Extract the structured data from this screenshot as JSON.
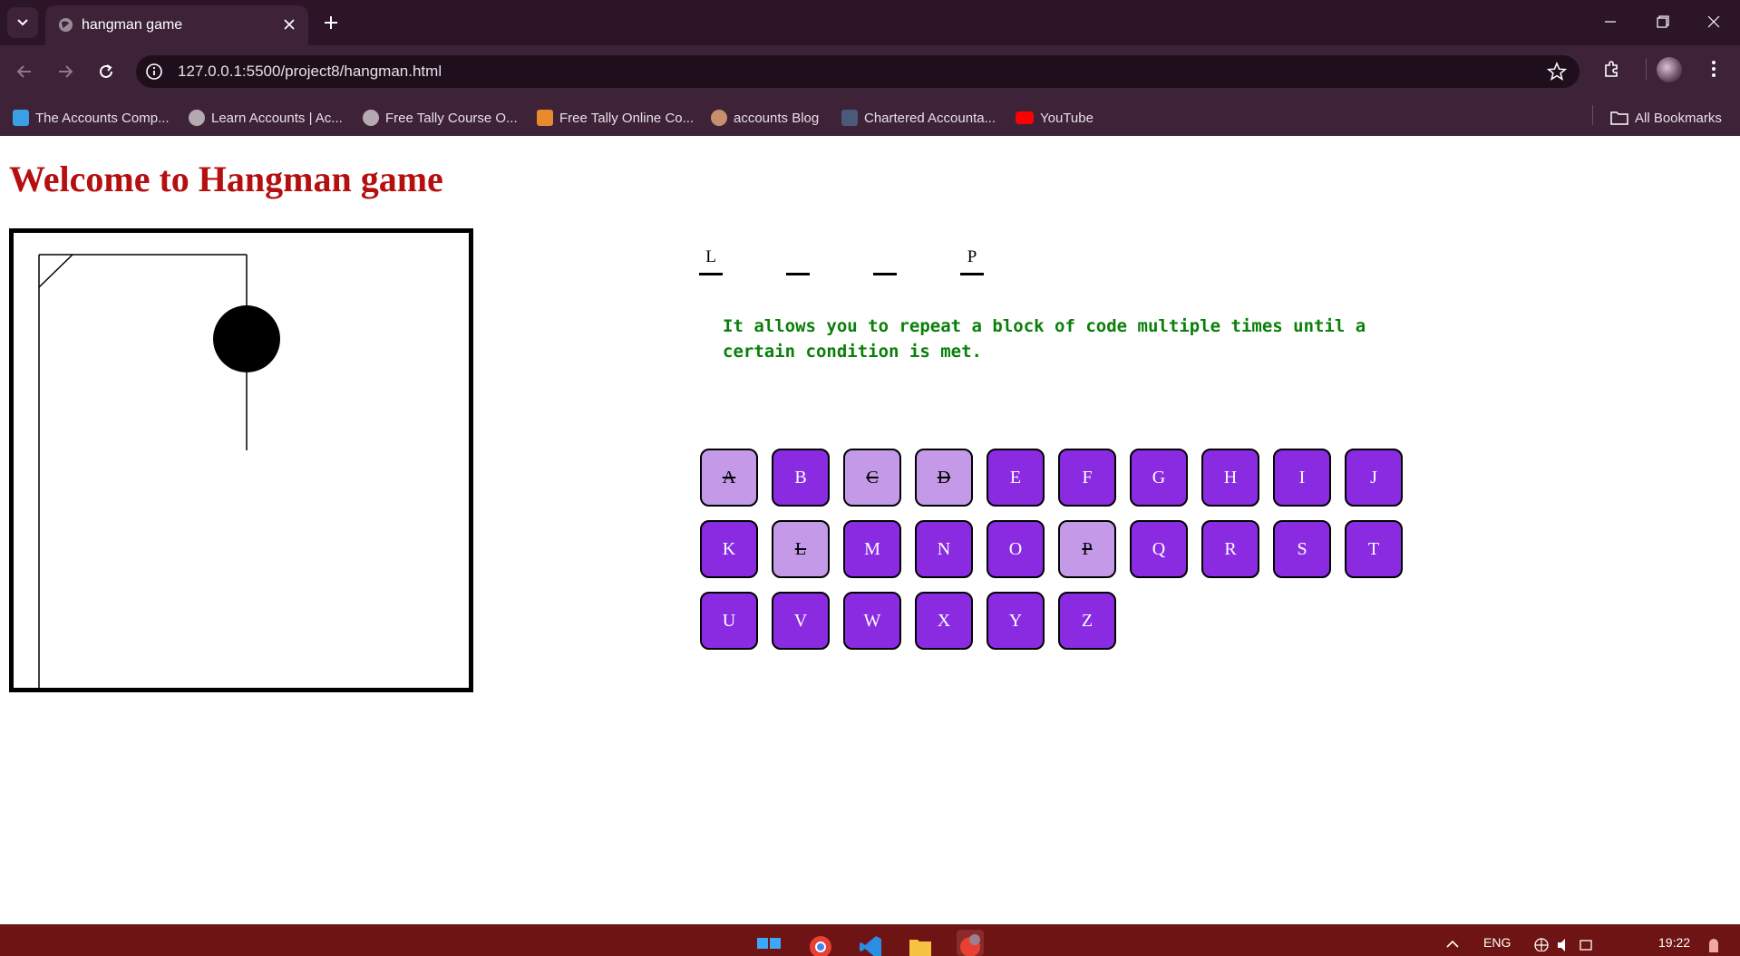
{
  "browser": {
    "tab_title": "hangman game",
    "url": "127.0.0.1:5500/project8/hangman.html",
    "bookmarks": [
      "The Accounts Comp...",
      "Learn Accounts | Ac...",
      "Free Tally Course O...",
      "Free Tally Online Co...",
      "accounts Blog",
      "Chartered Accounta...",
      "YouTube"
    ],
    "all_bookmarks": "All Bookmarks"
  },
  "page": {
    "heading": "Welcome to Hangman game",
    "word_slots": [
      "L",
      "",
      "",
      "P"
    ],
    "hint": "It allows you to repeat a block of code multiple times until a certain condition is met.",
    "keys": [
      {
        "letter": "A",
        "used": true
      },
      {
        "letter": "B",
        "used": false
      },
      {
        "letter": "C",
        "used": true
      },
      {
        "letter": "D",
        "used": true
      },
      {
        "letter": "E",
        "used": false
      },
      {
        "letter": "F",
        "used": false
      },
      {
        "letter": "G",
        "used": false
      },
      {
        "letter": "H",
        "used": false
      },
      {
        "letter": "I",
        "used": false
      },
      {
        "letter": "J",
        "used": false
      },
      {
        "letter": "K",
        "used": false
      },
      {
        "letter": "L",
        "used": true
      },
      {
        "letter": "M",
        "used": false
      },
      {
        "letter": "N",
        "used": false
      },
      {
        "letter": "O",
        "used": false
      },
      {
        "letter": "P",
        "used": true
      },
      {
        "letter": "Q",
        "used": false
      },
      {
        "letter": "R",
        "used": false
      },
      {
        "letter": "S",
        "used": false
      },
      {
        "letter": "T",
        "used": false
      },
      {
        "letter": "U",
        "used": false
      },
      {
        "letter": "V",
        "used": false
      },
      {
        "letter": "W",
        "used": false
      },
      {
        "letter": "X",
        "used": false
      },
      {
        "letter": "Y",
        "used": false
      },
      {
        "letter": "Z",
        "used": false
      }
    ],
    "colors": {
      "heading": "#b50f0f",
      "hint": "#0a7f0a",
      "key_active": "#8a2be2",
      "key_used": "#c49ae8"
    }
  },
  "taskbar": {
    "language": "ENG",
    "time": "19:22"
  }
}
